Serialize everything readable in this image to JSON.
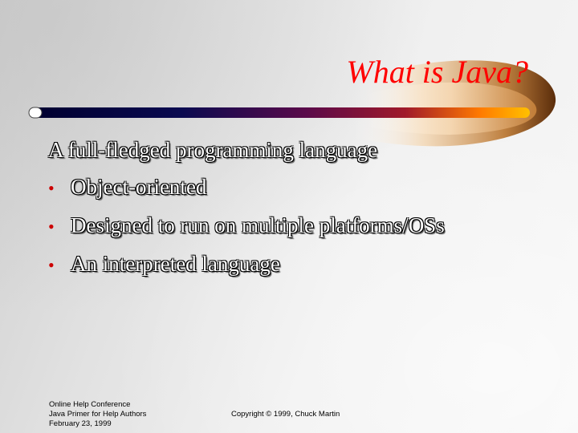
{
  "slide": {
    "title": "What is Java?",
    "lead": "A full-fledged programming language",
    "bullets": [
      "Object-oriented",
      "Designed to run on multiple platforms/OSs",
      "An interpreted language"
    ]
  },
  "footer": {
    "left_lines": [
      "Online Help Conference",
      "Java Primer for Help Authors",
      "February 23, 1999"
    ],
    "copyright": "Copyright © 1999, Chuck Martin"
  },
  "colors": {
    "title": "#ff0000",
    "bullet": "#cc0000",
    "bar_start": "#00003a",
    "bar_mid": "#7a0a3a",
    "bar_end": "#ffb000"
  },
  "icons": {
    "bullet": "bullet-dot-icon"
  }
}
